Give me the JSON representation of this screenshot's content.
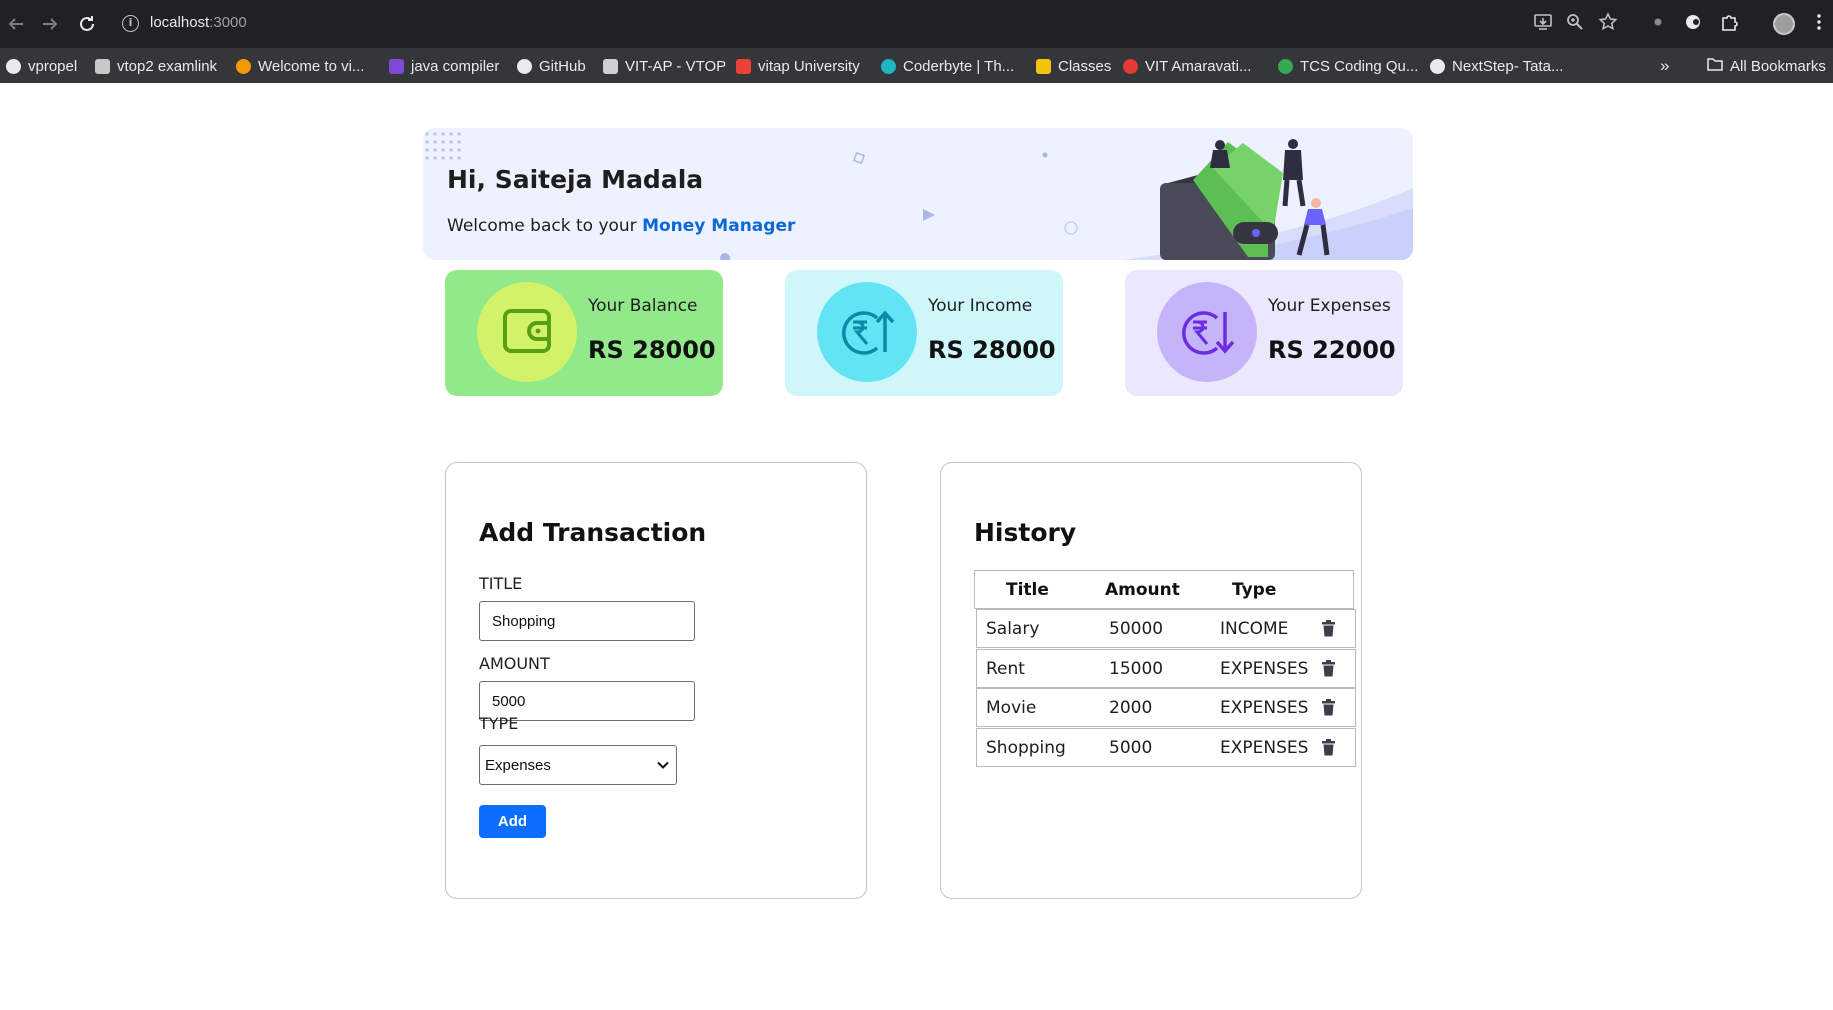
{
  "browser": {
    "url_host": "localhost",
    "url_port": ":3000",
    "bookmarks": [
      {
        "label": "vpropel",
        "color": "#e8eaed"
      },
      {
        "label": "vtop2 examlink",
        "color": "#c8c8c8"
      },
      {
        "label": "Welcome to vi...",
        "color": "#f29900"
      },
      {
        "label": "java compiler",
        "color": "#7b4bd8"
      },
      {
        "label": "GitHub",
        "color": "#e8eaed"
      },
      {
        "label": "VIT-AP - VTOP",
        "color": "#d0d0d0"
      },
      {
        "label": "vitap University",
        "color": "#ea4335"
      },
      {
        "label": "Coderbyte | Th...",
        "color": "#1fb6c1"
      },
      {
        "label": "Classes",
        "color": "#f4c20d"
      },
      {
        "label": "VIT Amaravati...",
        "color": "#e53935"
      },
      {
        "label": "TCS Coding Qu...",
        "color": "#34a853"
      },
      {
        "label": "NextStep- Tata...",
        "color": "#e8eaed"
      }
    ],
    "more_bookmarks": "»",
    "all_bookmarks": "All Bookmarks"
  },
  "banner": {
    "greeting": "Hi, Saiteja Madala",
    "welcome_prefix": "Welcome back to your ",
    "brand": "Money Manager"
  },
  "cards": [
    {
      "label": "Your Balance",
      "value": "RS 28000",
      "bg": "#92e98a",
      "circle": "#d2f26a",
      "icon": "wallet-icon"
    },
    {
      "label": "Your Income",
      "value": "RS 28000",
      "bg": "#cff7fa",
      "circle": "#63e4f5",
      "icon": "rupee-up-icon"
    },
    {
      "label": "Your Expenses",
      "value": "RS 22000",
      "bg": "#ebe7fd",
      "circle": "#c6b4fb",
      "icon": "rupee-down-icon"
    }
  ],
  "add_transaction": {
    "title": "Add Transaction",
    "title_label": "TITLE",
    "title_value": "Shopping",
    "amount_label": "AMOUNT",
    "amount_value": "5000",
    "type_label": "TYPE",
    "type_value": "Expenses",
    "add_button": "Add"
  },
  "history": {
    "title": "History",
    "columns": [
      "Title",
      "Amount",
      "Type"
    ],
    "rows": [
      {
        "title": "Salary",
        "amount": "50000",
        "type": "INCOME"
      },
      {
        "title": "Rent",
        "amount": "15000",
        "type": "EXPENSES"
      },
      {
        "title": "Movie",
        "amount": "2000",
        "type": "EXPENSES"
      },
      {
        "title": "Shopping",
        "amount": "5000",
        "type": "EXPENSES"
      }
    ]
  }
}
